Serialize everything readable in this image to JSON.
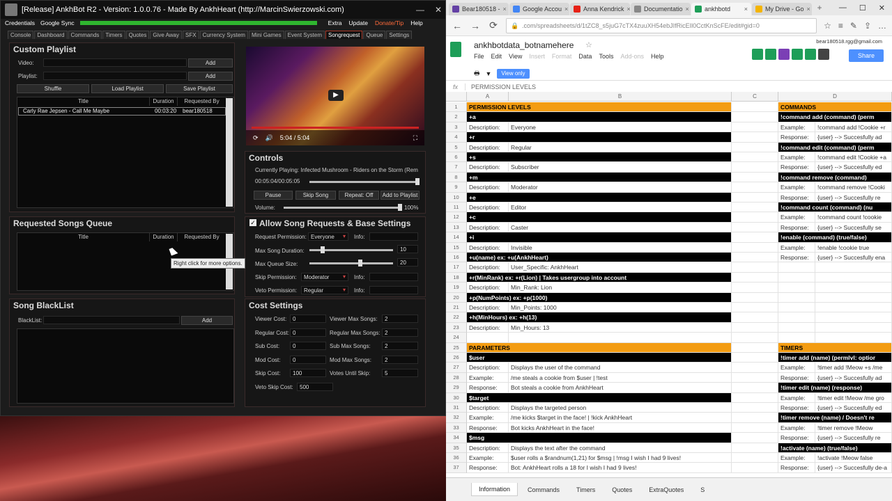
{
  "ankh": {
    "title": "[Release] AnkhBot R2 - Version: 1.0.0.76 - Made By AnkhHeart (http://MarcinSwierzowski.com)",
    "menu_left": [
      "Credentials",
      "Google Sync"
    ],
    "menu_right": [
      "Extra",
      "Update",
      "Donate/Tip",
      "Help"
    ],
    "tabs": [
      "Console",
      "Dashboard",
      "Commands",
      "Timers",
      "Quotes",
      "Give Away",
      "SFX",
      "Currency System",
      "Mini Games",
      "Event System",
      "Songrequest",
      "Queue",
      "Settings"
    ],
    "active_tab": "Songrequest",
    "custom_playlist": {
      "title": "Custom Playlist",
      "video_label": "Video:",
      "playlist_label": "Playlist:",
      "add1": "Add",
      "add2": "Add",
      "shuffle": "Shuffle",
      "load": "Load Playlist",
      "save": "Save Playlist",
      "headers": [
        "Title",
        "Duration",
        "Requested By"
      ],
      "rows": [
        {
          "title": "Carly Rae Jepsen - Call Me Maybe",
          "duration": "00:03:20",
          "by": "bear180518"
        }
      ]
    },
    "player": {
      "time": "5:04 / 5:04"
    },
    "controls": {
      "title": "Controls",
      "now_playing": "Currently Playing: Infected Mushroom - Riders on the Storm (Rem",
      "time": "00:05:04/00:05:05",
      "pause": "Pause",
      "skip": "Skip Song",
      "repeat": "Repeat: Off",
      "add_playlist": "Add to Playlist",
      "volume_label": "Volume:",
      "volume_value": "100%",
      "progress": 0.997,
      "volume": 1.0
    },
    "queue": {
      "title": "Requested Songs Queue",
      "headers": [
        "Title",
        "Duration",
        "Requested By"
      ],
      "tooltip": "Right click for more options."
    },
    "settings": {
      "title": "Allow Song Requests & Base Settings",
      "checked": true,
      "req_perm_label": "Request Permission:",
      "req_perm": "Everyone",
      "info1": "Info:",
      "max_dur_label": "Max Song Duration:",
      "max_dur": "10",
      "max_queue_label": "Max Queue Size:",
      "max_queue": "20",
      "skip_perm_label": "Skip Permission:",
      "skip_perm": "Moderator",
      "info2": "Info:",
      "veto_perm_label": "Veto Permission:",
      "veto_perm": "Regular",
      "info3": "Info:"
    },
    "blacklist": {
      "title": "Song BlackList",
      "label": "BlackList:",
      "add": "Add"
    },
    "cost": {
      "title": "Cost Settings",
      "left": [
        {
          "label": "Viewer Cost:",
          "value": "0"
        },
        {
          "label": "Regular Cost:",
          "value": "0"
        },
        {
          "label": "Sub Cost:",
          "value": "0"
        },
        {
          "label": "Mod Cost:",
          "value": "0"
        },
        {
          "label": "Skip Cost:",
          "value": "100"
        },
        {
          "label": "Veto Skip Cost:",
          "value": "500"
        }
      ],
      "right": [
        {
          "label": "Viewer Max Songs:",
          "value": "2"
        },
        {
          "label": "Regular Max Songs:",
          "value": "2"
        },
        {
          "label": "Sub Max Songs:",
          "value": "2"
        },
        {
          "label": "Mod Max Songs:",
          "value": "2"
        },
        {
          "label": "Votes Until Skip:",
          "value": "5"
        }
      ]
    }
  },
  "chrome": {
    "tabs": [
      {
        "label": "Bear180518 -",
        "color": "#6441a5"
      },
      {
        "label": "Google Accou",
        "color": "#4285f4"
      },
      {
        "label": "Anna Kendrick",
        "color": "#e62117"
      },
      {
        "label": "Documentatio",
        "color": "#888888"
      },
      {
        "label": "ankhbotd",
        "color": "#1e9e58",
        "active": true
      },
      {
        "label": "My Drive - Go",
        "color": "#f4b400"
      }
    ],
    "url": ".com/spreadsheets/d/1tZC8_s5juG7cTX4zuuXH54ebJIfRicEIl0CctKnScFE/edit#gid=0",
    "doc_title": "ankhbotdata_botnamehere",
    "menu": [
      "File",
      "Edit",
      "View",
      "Insert",
      "Format",
      "Data",
      "Tools",
      "Add-ons",
      "Help"
    ],
    "account": "bear180518.rgg@gmail.com",
    "share": "Share",
    "view_only": "View only",
    "fx_value": "PERMISSION LEVELS",
    "sheet_tabs": [
      "Information",
      "Commands",
      "Timers",
      "Quotes",
      "ExtraQuotes",
      "S"
    ],
    "cols": [
      "A",
      "B",
      "C",
      "D"
    ]
  },
  "rows": [
    {
      "n": "1",
      "a": "PERMISSION LEVELS",
      "ta": "orange",
      "d": "COMMANDS",
      "td": "orange"
    },
    {
      "n": "2",
      "a": "+a",
      "ta": "black",
      "d": "!command add (command) (perm",
      "td": "black"
    },
    {
      "n": "3",
      "a": "Description:",
      "b": "Everyone",
      "d": "Example:",
      "e": "!command add !Cookie +r"
    },
    {
      "n": "4",
      "a": "+r",
      "ta": "black",
      "d": "Response:",
      "e": "{user} --> Succesfully ad"
    },
    {
      "n": "5",
      "a": "Description:",
      "b": "Regular",
      "d": "!command edit (command) (perm",
      "td": "black"
    },
    {
      "n": "6",
      "a": "+s",
      "ta": "black",
      "d": "Example:",
      "e": "!command edit !Cookie +a"
    },
    {
      "n": "7",
      "a": "Description:",
      "b": "Subscriber",
      "d": "Response:",
      "e": "{user} --> Succesfully ed"
    },
    {
      "n": "8",
      "a": "+m",
      "ta": "black",
      "d": "!command remove (command)",
      "td": "black"
    },
    {
      "n": "9",
      "a": "Description:",
      "b": "Moderator",
      "d": "Example:",
      "e": "!command remove !Cooki"
    },
    {
      "n": "10",
      "a": "+e",
      "ta": "black",
      "d": "Response:",
      "e": "{user} --> Succesfully re"
    },
    {
      "n": "11",
      "a": "Description:",
      "b": "Editor",
      "d": "!command count (command) (nu",
      "td": "black"
    },
    {
      "n": "12",
      "a": "+c",
      "ta": "black",
      "d": "Example:",
      "e": "!command count !cookie"
    },
    {
      "n": "13",
      "a": "Description:",
      "b": "Caster",
      "d": "Response:",
      "e": "{user} --> Succesfully se"
    },
    {
      "n": "14",
      "a": "+i",
      "ta": "black",
      "d": "!enable (command) (true/false)",
      "td": "black"
    },
    {
      "n": "15",
      "a": "Description:",
      "b": "Invisible",
      "d": "Example:",
      "e": "!enable !cookie true"
    },
    {
      "n": "16",
      "a": "+u(name) ex: +u(AnkhHeart)",
      "ta": "black",
      "d": "Response:",
      "e": "{user} --> Succesfully ena"
    },
    {
      "n": "17",
      "a": "Description:",
      "b": "User_Specific: AnkhHeart"
    },
    {
      "n": "18",
      "a": "+r(MinRank) ex: +r(Lion) | Takes usergroup into account",
      "ta": "black"
    },
    {
      "n": "19",
      "a": "Description:",
      "b": "Min_Rank: Lion"
    },
    {
      "n": "20",
      "a": "+p(NumPoints) ex: +p(1000)",
      "ta": "black"
    },
    {
      "n": "21",
      "a": "Description:",
      "b": "Min_Points: 1000"
    },
    {
      "n": "22",
      "a": "+h(MinHours) ex: +h(13)",
      "ta": "black"
    },
    {
      "n": "23",
      "a": "Description:",
      "b": "Min_Hours: 13"
    },
    {
      "n": "24"
    },
    {
      "n": "25",
      "a": "PARAMETERS",
      "ta": "orange",
      "d": "TIMERS",
      "td": "orange"
    },
    {
      "n": "26",
      "a": "$user",
      "ta": "black",
      "d": "!timer add (name) (permlvl: optior",
      "td": "black"
    },
    {
      "n": "27",
      "a": "Description:",
      "b": "Displays the user of the command",
      "d": "Example:",
      "e": "!timer add !Meow +s /me"
    },
    {
      "n": "28",
      "a": "Example:",
      "b": "/me steals a cookie from $user | !test",
      "d": "Response:",
      "e": "{user} --> Succesfully ad"
    },
    {
      "n": "29",
      "a": "Response:",
      "b": "Bot steals a cookie from AnkhHeart",
      "d": "!timer edit (name) (response)",
      "td": "black"
    },
    {
      "n": "30",
      "a": "$target",
      "ta": "black",
      "d": "Example:",
      "e": "!timer edit !Meow  /me gro"
    },
    {
      "n": "31",
      "a": "Description:",
      "b": "Displays the targeted person",
      "d": "Response:",
      "e": "{user} --> Succesfully ed"
    },
    {
      "n": "32",
      "a": "Example:",
      "b": "/me kicks $target in the face! | !kick AnkhHeart",
      "d": "!timer remove (name) / Doesn't re",
      "td": "black"
    },
    {
      "n": "33",
      "a": "Response:",
      "b": "Bot kicks AnkhHeart in the face!",
      "d": "Example:",
      "e": "!timer remove !Meow"
    },
    {
      "n": "34",
      "a": "$msg",
      "ta": "black",
      "d": "Response:",
      "e": "{user} --> Succesfully re"
    },
    {
      "n": "35",
      "a": "Description:",
      "b": "Displays the text after the command",
      "d": "!activate (name) (true/false)",
      "td": "black"
    },
    {
      "n": "36",
      "a": "Example:",
      "b": "$user rolls a $randnum(1,21) for $msg | !msg I wish I had 9 lives!",
      "d": "Example:",
      "e": "!activate !Meow false"
    },
    {
      "n": "37",
      "a": "Response:",
      "b": "Bot: AnkhHeart rolls a 18 for I wish I had 9 lives!",
      "d": "Response:",
      "e": "{user} --> Succesfully de-a"
    }
  ]
}
